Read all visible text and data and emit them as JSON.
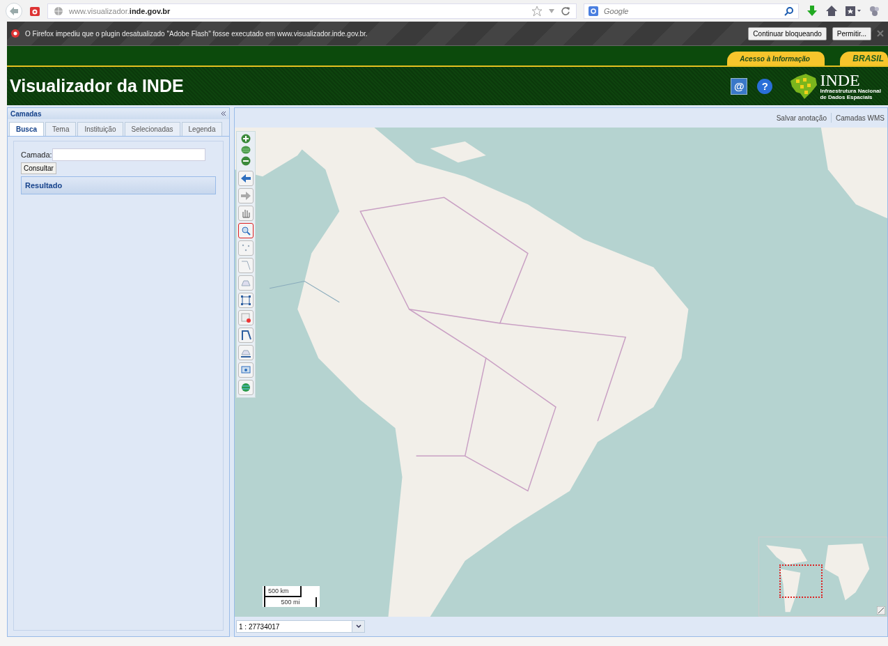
{
  "browser": {
    "url": "www.visualizador.**inde.gov.br**",
    "search_placeholder": "Google"
  },
  "plugin_bar": {
    "message": "O Firefox impediu que o plugin desatualizado \"Adobe Flash\" fosse executado em www.visualizador.inde.gov.br.",
    "buttons": [
      "Continuar bloqueando",
      "Permitir..."
    ]
  },
  "gov_bar": {
    "links": [
      "Acesso à Informação",
      "BRASIL"
    ]
  },
  "header": {
    "title": "Visualizador da INDE",
    "icons": [
      "@",
      "?"
    ],
    "logo": {
      "name": "INDE",
      "subtitle_lines": [
        "Infraestrutura Nacional",
        "de Dados Espaciais"
      ]
    }
  },
  "sidebar": {
    "title": "Camadas",
    "tabs": [
      {
        "label": "Busca",
        "selected": true
      },
      {
        "label": "Tema",
        "selected": false
      },
      {
        "label": "Instituição",
        "selected": false
      },
      {
        "label": "Selecionadas",
        "selected": false
      },
      {
        "label": "Legenda",
        "selected": false
      }
    ],
    "field_label": "Camada:",
    "button": "Consultar",
    "result_heading": "Resultado"
  },
  "map": {
    "links": [
      "Salvar anotação",
      "Camadas WMS"
    ],
    "tools": [
      {
        "kind": "back",
        "selected": false
      },
      {
        "kind": "forward",
        "selected": false
      },
      {
        "kind": "pan",
        "selected": false
      },
      {
        "kind": "zoom-box",
        "selected": true
      },
      {
        "kind": "point",
        "selected": false
      },
      {
        "kind": "line",
        "selected": false
      },
      {
        "kind": "polygon",
        "selected": false
      },
      {
        "kind": "extent",
        "selected": false
      },
      {
        "kind": "clear",
        "selected": false
      },
      {
        "kind": "measure-line",
        "selected": false
      },
      {
        "kind": "measure-area",
        "selected": false
      },
      {
        "kind": "screen",
        "selected": false
      },
      {
        "kind": "globe",
        "selected": false
      }
    ],
    "scale_bar": [
      "500 km",
      "500 mi"
    ],
    "scale_value": "1 : 27734017"
  }
}
